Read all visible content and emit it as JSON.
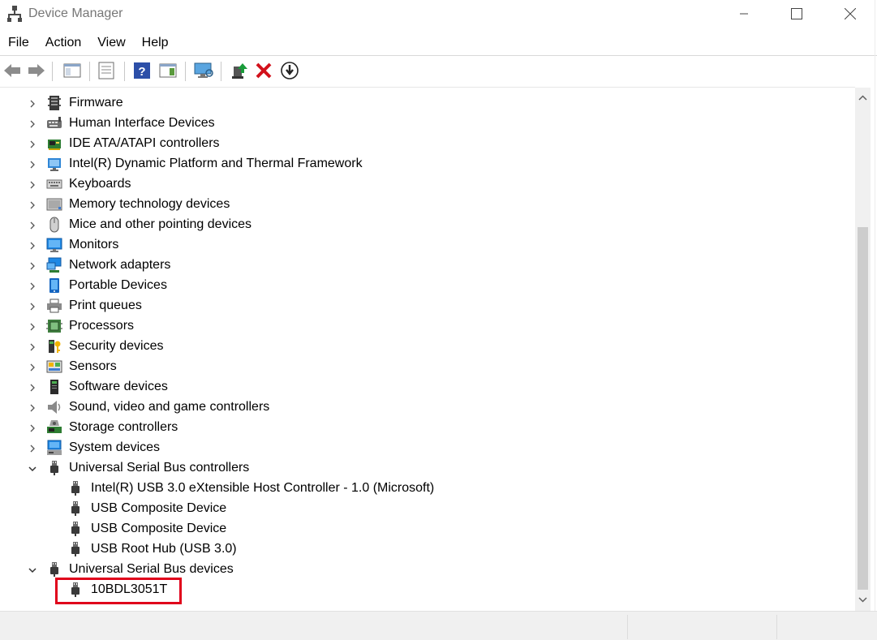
{
  "window": {
    "title": "Device Manager"
  },
  "menu": [
    "File",
    "Action",
    "View",
    "Help"
  ],
  "toolbar": {
    "buttons": [
      "back-icon",
      "forward-icon",
      "show-hide-console-tree-icon",
      "properties-icon",
      "help-icon",
      "action-pane-icon",
      "scan-hardware-icon",
      "update-driver-icon",
      "uninstall-device-icon",
      "disable-device-icon"
    ]
  },
  "tree": {
    "items": [
      {
        "label": "Firmware",
        "icon": "firmware-icon",
        "level": 0,
        "state": "collapsed"
      },
      {
        "label": "Human Interface Devices",
        "icon": "hid-icon",
        "level": 0,
        "state": "collapsed"
      },
      {
        "label": "IDE ATA/ATAPI controllers",
        "icon": "ide-controller-icon",
        "level": 0,
        "state": "collapsed"
      },
      {
        "label": "Intel(R) Dynamic Platform and Thermal Framework",
        "icon": "thermal-framework-icon",
        "level": 0,
        "state": "collapsed"
      },
      {
        "label": "Keyboards",
        "icon": "keyboard-icon",
        "level": 0,
        "state": "collapsed"
      },
      {
        "label": "Memory technology devices",
        "icon": "memory-device-icon",
        "level": 0,
        "state": "collapsed"
      },
      {
        "label": "Mice and other pointing devices",
        "icon": "mouse-icon",
        "level": 0,
        "state": "collapsed"
      },
      {
        "label": "Monitors",
        "icon": "monitor-icon",
        "level": 0,
        "state": "collapsed"
      },
      {
        "label": "Network adapters",
        "icon": "network-adapter-icon",
        "level": 0,
        "state": "collapsed"
      },
      {
        "label": "Portable Devices",
        "icon": "portable-device-icon",
        "level": 0,
        "state": "collapsed"
      },
      {
        "label": "Print queues",
        "icon": "printer-icon",
        "level": 0,
        "state": "collapsed"
      },
      {
        "label": "Processors",
        "icon": "processor-icon",
        "level": 0,
        "state": "collapsed"
      },
      {
        "label": "Security devices",
        "icon": "security-device-icon",
        "level": 0,
        "state": "collapsed"
      },
      {
        "label": "Sensors",
        "icon": "sensor-icon",
        "level": 0,
        "state": "collapsed"
      },
      {
        "label": "Software devices",
        "icon": "software-device-icon",
        "level": 0,
        "state": "collapsed"
      },
      {
        "label": "Sound, video and game controllers",
        "icon": "speaker-icon",
        "level": 0,
        "state": "collapsed"
      },
      {
        "label": "Storage controllers",
        "icon": "storage-controller-icon",
        "level": 0,
        "state": "collapsed"
      },
      {
        "label": "System devices",
        "icon": "system-device-icon",
        "level": 0,
        "state": "collapsed"
      },
      {
        "label": "Universal Serial Bus controllers",
        "icon": "usb-icon",
        "level": 0,
        "state": "expanded"
      },
      {
        "label": "Intel(R) USB 3.0 eXtensible Host Controller - 1.0 (Microsoft)",
        "icon": "usb-icon",
        "level": 1
      },
      {
        "label": "USB Composite Device",
        "icon": "usb-icon",
        "level": 1
      },
      {
        "label": "USB Composite Device",
        "icon": "usb-icon",
        "level": 1
      },
      {
        "label": "USB Root Hub (USB 3.0)",
        "icon": "usb-icon",
        "level": 1
      },
      {
        "label": "Universal Serial Bus devices",
        "icon": "usb-icon",
        "level": 0,
        "state": "expanded"
      },
      {
        "label": "10BDL3051T",
        "icon": "usb-icon",
        "level": 1,
        "highlighted": true
      }
    ]
  },
  "colors": {
    "highlight": "#e0001b",
    "scrollbar_thumb": "#cdcdcd",
    "statusbar": "#f0f0f0"
  }
}
